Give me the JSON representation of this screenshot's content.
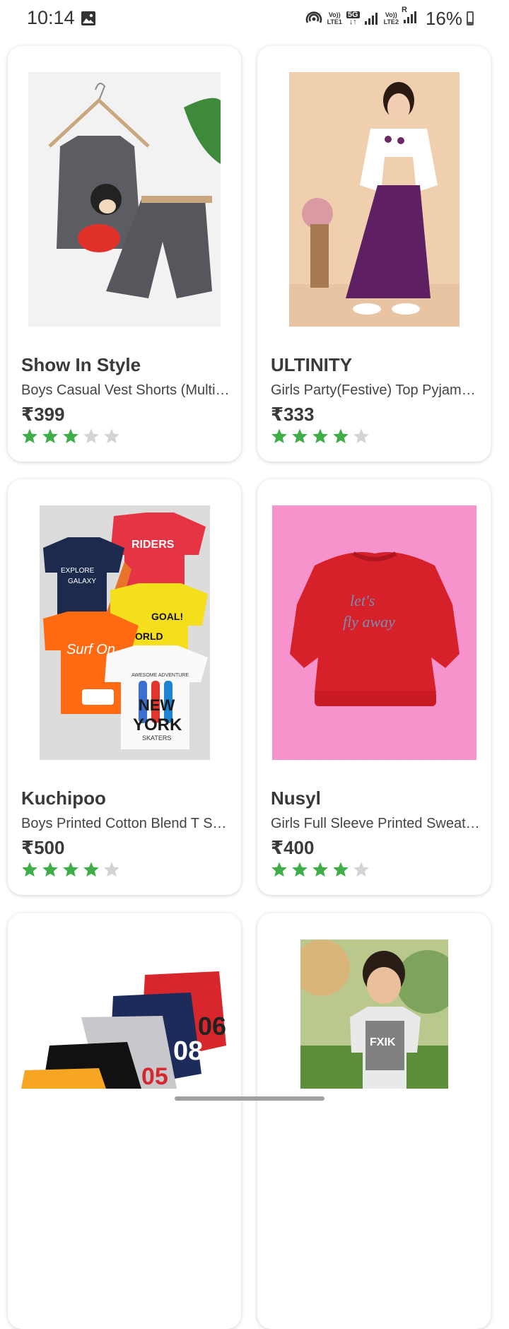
{
  "status_bar": {
    "time": "10:14",
    "sim1_label_top": "Vo))",
    "sim1_label_bottom": "LTE1",
    "network_badge": "5G",
    "sim2_label_top": "Vo))",
    "sim2_label_bottom": "LTE2",
    "roaming_label": "R",
    "battery_text": "16%",
    "battery_level": 0.16
  },
  "products": [
    {
      "brand": "Show In Style",
      "description": "Boys Casual Vest Shorts  (Multicolor)",
      "price": "₹399",
      "rating": 3
    },
    {
      "brand": "ULTINITY",
      "description": "Girls Party(Festive) Top Pyjama Set",
      "price": "₹333",
      "rating": 4
    },
    {
      "brand": "Kuchipoo",
      "description": "Boys Printed Cotton Blend T Shirt",
      "price": "₹500",
      "rating": 4
    },
    {
      "brand": "Nusyl",
      "description": "Girls Full Sleeve Printed Sweatshirt",
      "price": "₹400",
      "rating": 4
    },
    {
      "brand": "",
      "description": "",
      "price": "",
      "rating": 0
    },
    {
      "brand": "",
      "description": "",
      "price": "",
      "rating": 0
    }
  ],
  "product_images": {
    "img1_text": "",
    "img3_text_top": "EXPLORE",
    "img3_text_galaxy": "GALAXY",
    "img3_text_riders": "RIDERS",
    "img3_text_goal": "GOAL!",
    "img3_text_orld": "ORLD",
    "img3_text_surf": "Surf On",
    "img3_text_awesome": "AWESOME ADVENTURE",
    "img3_text_new": "NEW",
    "img3_text_york": "YORK",
    "img3_text_skaters": "SKATERS",
    "img4_text1": "let's",
    "img4_text2": "fly away",
    "img5_num1": "06",
    "img5_num2": "08",
    "img5_num3": "05",
    "img6_text": "FXIK"
  },
  "colors": {
    "star_filled": "#3fae49",
    "star_empty": "#d3d3d3"
  }
}
